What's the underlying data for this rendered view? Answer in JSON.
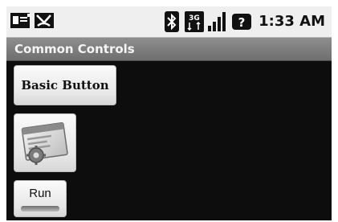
{
  "status_bar": {
    "time": "1:33 AM",
    "icons": [
      "notification-icon",
      "missed-call-icon",
      "bluetooth-icon",
      "3g-icon",
      "signal-icon",
      "battery-icon"
    ],
    "network_label": "3G"
  },
  "title_bar": {
    "title": "Common Controls"
  },
  "controls": {
    "basic_button_label": "Basic Button",
    "image_button_icon": "window-settings-icon",
    "toggle_button_label": "Run"
  }
}
